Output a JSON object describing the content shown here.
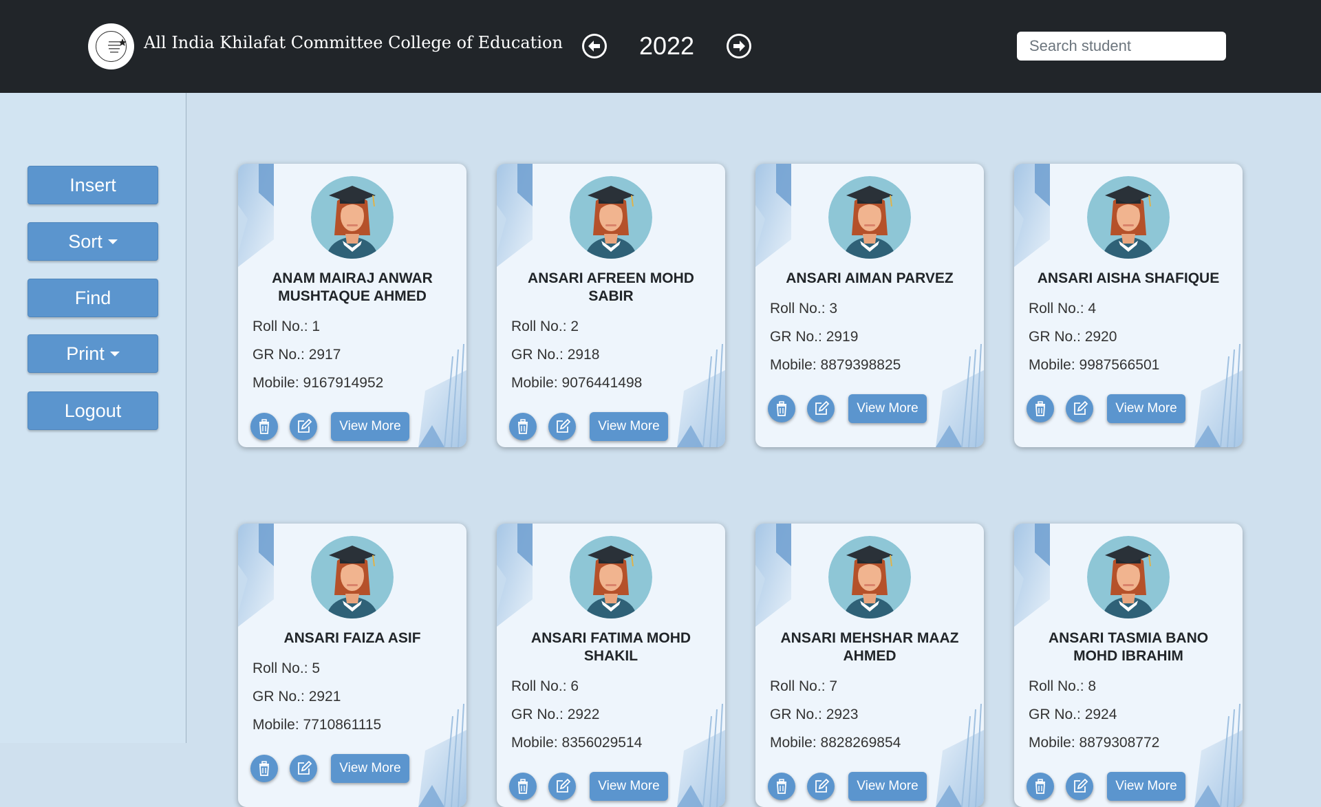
{
  "header": {
    "college_name": "All India Khilafat Committee College of Education",
    "year": "2022",
    "search_placeholder": "Search student"
  },
  "sidebar": {
    "insert": "Insert",
    "sort": "Sort",
    "find": "Find",
    "print": "Print",
    "logout": "Logout"
  },
  "labels": {
    "roll": "Roll No.: ",
    "gr": "GR No.: ",
    "mobile": "Mobile: ",
    "view_more": "View More"
  },
  "students": [
    {
      "name": "ANAM MAIRAJ ANWAR MUSHTAQUE AHMED",
      "roll": "1",
      "gr": "2917",
      "mobile": "9167914952"
    },
    {
      "name": "ANSARI AFREEN MOHD SABIR",
      "roll": "2",
      "gr": "2918",
      "mobile": "9076441498"
    },
    {
      "name": "ANSARI AIMAN PARVEZ",
      "roll": "3",
      "gr": "2919",
      "mobile": "8879398825"
    },
    {
      "name": "ANSARI AISHA SHAFIQUE",
      "roll": "4",
      "gr": "2920",
      "mobile": "9987566501"
    },
    {
      "name": "ANSARI FAIZA ASIF",
      "roll": "5",
      "gr": "2921",
      "mobile": "7710861115"
    },
    {
      "name": "ANSARI FATIMA MOHD SHAKIL",
      "roll": "6",
      "gr": "2922",
      "mobile": "8356029514"
    },
    {
      "name": "ANSARI MEHSHAR MAAZ AHMED",
      "roll": "7",
      "gr": "2923",
      "mobile": "8828269854"
    },
    {
      "name": "ANSARI TASMIA BANO MOHD IBRAHIM",
      "roll": "8",
      "gr": "2924",
      "mobile": "8879308772"
    }
  ],
  "icons": {
    "logo": "college-logo-icon",
    "prev": "arrow-left-circle-icon",
    "next": "arrow-right-circle-icon",
    "delete": "trash-icon",
    "edit": "edit-icon",
    "avatar": "graduate-avatar-icon"
  },
  "colors": {
    "header_bg": "#212529",
    "page_bg": "#cfe0ee",
    "accent": "#5b95ce",
    "card_bg": "#eef5fc"
  }
}
